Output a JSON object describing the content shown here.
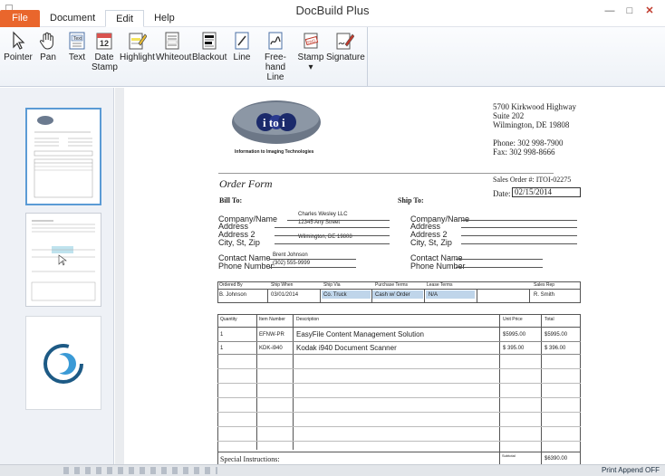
{
  "window": {
    "title": "DocBuild Plus"
  },
  "menu": {
    "tabs": [
      "File",
      "Document",
      "Edit",
      "Help"
    ],
    "active": "Edit"
  },
  "ribbon": {
    "tools": [
      {
        "label": "Pointer",
        "icon": "pointer-icon"
      },
      {
        "label": "Pan",
        "icon": "hand-icon"
      },
      {
        "label": "Text",
        "icon": "text-icon"
      },
      {
        "label": "Date\nStamp",
        "icon": "calendar-icon"
      },
      {
        "label": "Highlight",
        "icon": "highlight-icon"
      },
      {
        "label": "Whiteout",
        "icon": "whiteout-icon"
      },
      {
        "label": "Blackout",
        "icon": "blackout-icon"
      },
      {
        "label": "Line",
        "icon": "line-icon"
      },
      {
        "label": "Free-hand\nLine",
        "icon": "freehand-icon"
      },
      {
        "label": "Stamp",
        "icon": "stamp-icon"
      },
      {
        "label": "Signature",
        "icon": "signature-icon"
      }
    ],
    "stamp_dropdown": "▾"
  },
  "doc": {
    "logo_text": "i to i",
    "logo_tagline": "Information to Imaging Technologies",
    "address": [
      "5700 Kirkwood Highway",
      "Suite 202",
      "Wilmington, DE  19808"
    ],
    "phone": "Phone:  302 998-7900",
    "fax": "Fax:    302 998-8666",
    "form_title": "Order Form",
    "sales_order": "Sales Order #:  ITOI-02275",
    "date_label": "Date:",
    "date_value": "02/15/2014",
    "bill_to": "Bill To:",
    "ship_to": "Ship To:",
    "labels": {
      "company": "Company/Name",
      "address": "Address",
      "address2": "Address 2",
      "city": "City, St, Zip",
      "contact": "Contact Name",
      "phone": "Phone Number"
    },
    "bill": {
      "company": "Charles Wesley LLC",
      "address": "12345 Any Street",
      "city": "Wilmington, DE  19808",
      "contact": "Brent Johnson",
      "phone": "(302) 555-9999"
    },
    "order_headers": [
      "Ordered By",
      "Ship When",
      "Ship Via",
      "Purchase Terms",
      "Lease Terms",
      "Sales Rep"
    ],
    "order_values": [
      "B. Johnson",
      "03/01/2014",
      "Co. Truck",
      "Cash w/ Order",
      "N/A",
      "R. Smith"
    ],
    "item_headers": [
      "Quantity",
      "Item Number",
      "Description",
      "Unit Price",
      "Total"
    ],
    "items": [
      {
        "qty": "1",
        "item": "EFNW-PR",
        "desc": "EasyFile Content Management Solution",
        "unit": "$5995.00",
        "total": "$5995.00"
      },
      {
        "qty": "1",
        "item": "KDK-i940",
        "desc": "Kodak i940 Document Scanner",
        "unit": "$  395.00",
        "total": "$  396.00"
      }
    ],
    "special_instructions": "Special Instructions:",
    "subtotal_label": "Subtotal",
    "subtotal_value": "$6390.00"
  },
  "status": {
    "right": "Print Append OFF"
  }
}
